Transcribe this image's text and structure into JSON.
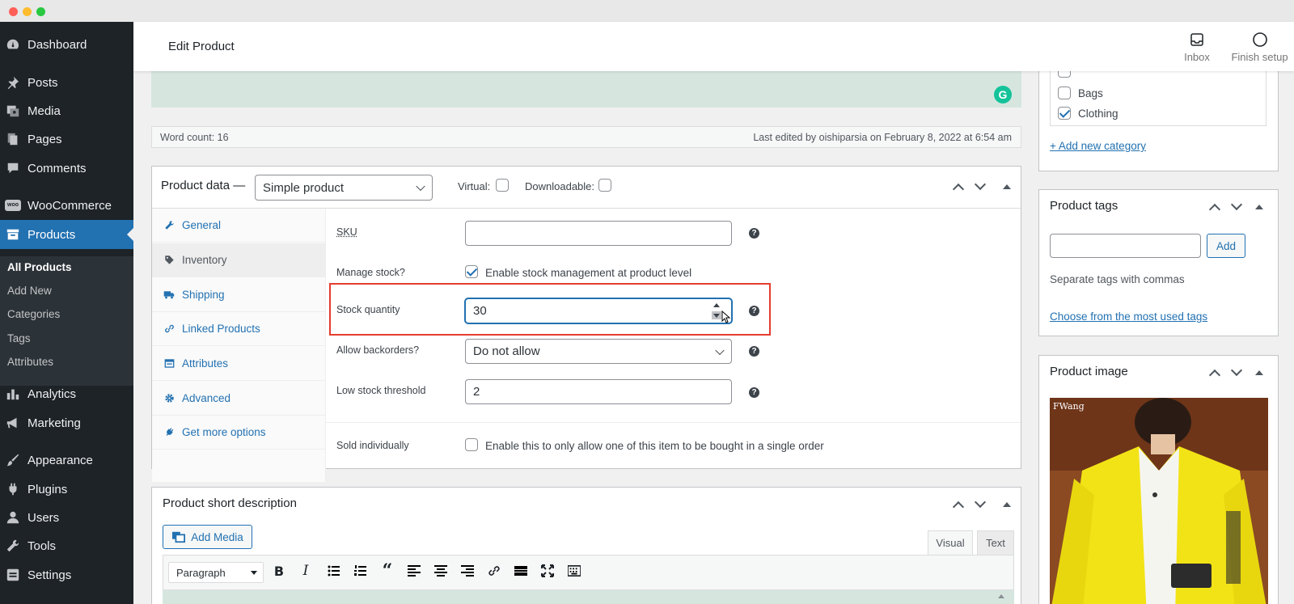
{
  "sidebar": {
    "items": [
      {
        "label": "Dashboard",
        "icon": "dashboard-icon"
      },
      {
        "label": "Posts",
        "icon": "pin-icon"
      },
      {
        "label": "Media",
        "icon": "media-icon"
      },
      {
        "label": "Pages",
        "icon": "pages-icon"
      },
      {
        "label": "Comments",
        "icon": "comment-icon"
      },
      {
        "label": "WooCommerce",
        "icon": "woo-icon"
      },
      {
        "label": "Products",
        "icon": "archive-icon"
      },
      {
        "label": "Analytics",
        "icon": "bar-chart-icon"
      },
      {
        "label": "Marketing",
        "icon": "megaphone-icon"
      },
      {
        "label": "Appearance",
        "icon": "brush-icon"
      },
      {
        "label": "Plugins",
        "icon": "plugin-icon"
      },
      {
        "label": "Users",
        "icon": "user-icon"
      },
      {
        "label": "Tools",
        "icon": "wrench-icon"
      },
      {
        "label": "Settings",
        "icon": "settings-icon"
      }
    ],
    "submenu": [
      "All Products",
      "Add New",
      "Categories",
      "Tags",
      "Attributes"
    ],
    "woo_badge": "woo"
  },
  "header": {
    "title": "Edit Product",
    "inbox": "Inbox",
    "finish_setup": "Finish setup"
  },
  "editor": {
    "word_count": "Word count: 16",
    "last_edited": "Last edited by oishiparsia on February 8, 2022 at 6:54 am",
    "grammarly": "G"
  },
  "product_data": {
    "title": "Product data —",
    "type": "Simple product",
    "virtual": "Virtual:",
    "downloadable": "Downloadable:",
    "tabs": [
      "General",
      "Inventory",
      "Shipping",
      "Linked Products",
      "Attributes",
      "Advanced",
      "Get more options"
    ],
    "fields": {
      "sku_label": "SKU",
      "sku_value": "",
      "manage_label": "Manage stock?",
      "manage_text": "Enable stock management at product level",
      "qty_label": "Stock quantity",
      "qty_value": "30",
      "backorders_label": "Allow backorders?",
      "backorders_value": "Do not allow",
      "low_label": "Low stock threshold",
      "low_value": "2",
      "sold_label": "Sold individually",
      "sold_text": "Enable this to only allow one of this item to be bought in a single order"
    },
    "help": "?"
  },
  "short_description": {
    "title": "Product short description",
    "add_media": "Add Media",
    "visual_tab": "Visual",
    "text_tab": "Text",
    "format": "Paragraph"
  },
  "categories": {
    "items": [
      {
        "label": "Bags",
        "checked": false
      },
      {
        "label": "Clothing",
        "checked": true
      }
    ],
    "add_new": "+ Add new category"
  },
  "tags": {
    "title": "Product tags",
    "add": "Add",
    "hint": "Separate tags with commas",
    "choose": "Choose from the most used tags"
  },
  "image": {
    "title": "Product image",
    "watermark": "FWang"
  },
  "colors": {
    "sidebar": "#1d2327",
    "active": "#2271b1",
    "highlight": "#e43c2f",
    "editor_bg": "#d6e6df"
  }
}
